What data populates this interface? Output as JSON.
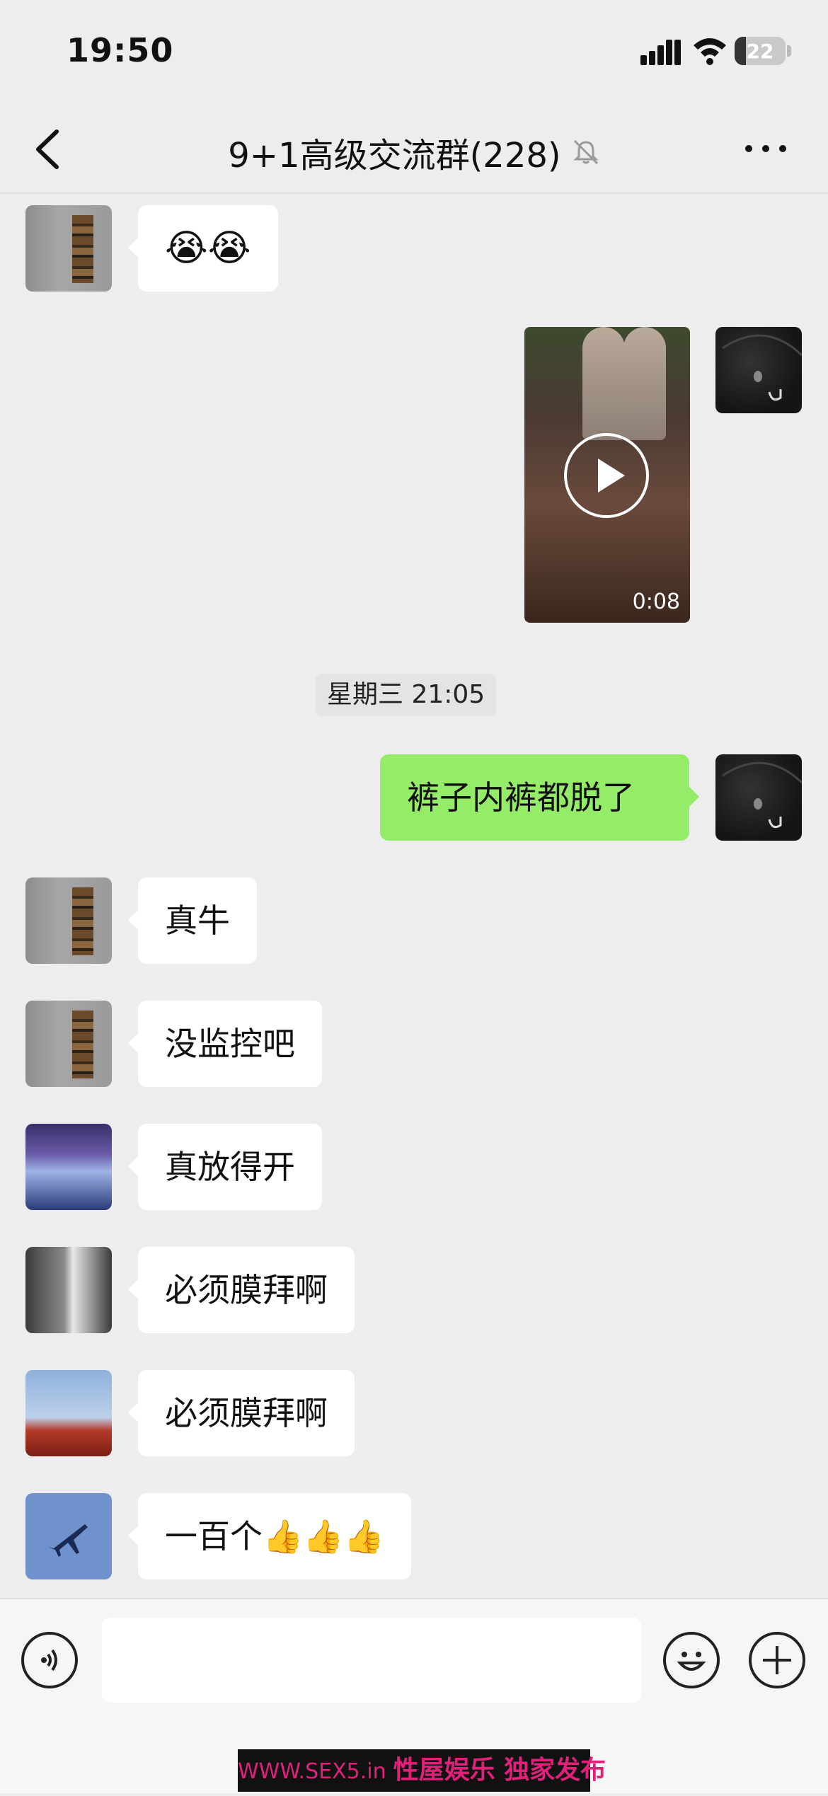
{
  "status_bar": {
    "time": "19:50",
    "battery": "22",
    "battery_level": 0.22
  },
  "header": {
    "title": "9+1高级交流群(228)"
  },
  "messages": [
    {
      "side": "left",
      "text": "😭😭"
    },
    {
      "side": "right",
      "type": "video",
      "duration": "0:08"
    },
    {
      "type": "timestamp",
      "text": "星期三 21:05"
    },
    {
      "side": "right",
      "text": "裤子内裤都脱了"
    },
    {
      "side": "left",
      "text": "真牛"
    },
    {
      "side": "left",
      "text": "没监控吧"
    },
    {
      "side": "left",
      "text": "真放得开"
    },
    {
      "side": "left",
      "text": "必须膜拜啊"
    },
    {
      "side": "left",
      "text": "必须膜拜啊"
    },
    {
      "side": "left",
      "text": "一百个👍👍👍"
    }
  ],
  "watermark": {
    "url": "WWW.SEX5.in",
    "text": "性屋娱乐 独家发布"
  },
  "colors": {
    "background": "#ededed",
    "outgoing_bubble": "#95ec69",
    "incoming_bubble": "#ffffff",
    "watermark": "#e0207a"
  }
}
